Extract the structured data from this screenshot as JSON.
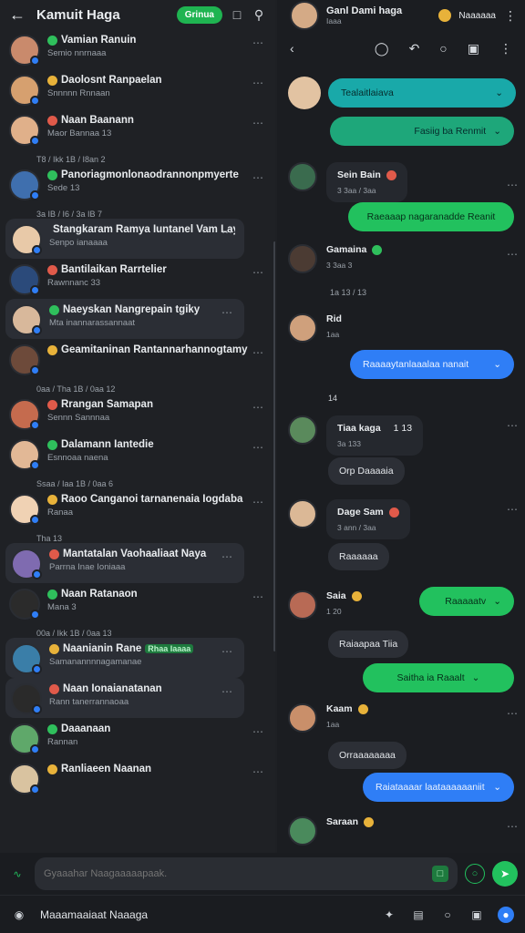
{
  "left": {
    "title": "Kamuit Haga",
    "badge": "Grinua",
    "chats": [
      {
        "name": "Vamian Ranuin",
        "sub": "Semio nnrnaaa",
        "color": "#c98a6c",
        "time": ""
      },
      {
        "name": "Daolosnt Ranpaelan",
        "sub": "Snnnnn Rnnaan",
        "color": "#d6a06f",
        "time": ""
      },
      {
        "name": "Naan Baanann",
        "sub": "Maor Bannaa 13",
        "color": "#e0b08a",
        "time": "T8 / Ikk 1B / I8an 2"
      },
      {
        "name": "Panoriagmonlonaodrannonpmyerte",
        "sub": "Sede 13",
        "color": "#3f6fae",
        "time": "3a IB / I6 / 3a IB 7"
      },
      {
        "name": "Stangkaram Ramya Iuntanel Vam Lay",
        "sub": "Senpo ianaaaa",
        "color": "#e8c9a8",
        "time": ""
      },
      {
        "name": "Bantilaikan Rarrtelier",
        "sub": "Rawnnanc 33",
        "color": "#2b4a7a",
        "time": ""
      },
      {
        "name": "Naeyskan Nangrepain tgiky",
        "sub": "Mta inannarassannaat",
        "color": "#d8b89b",
        "time": ""
      },
      {
        "name": "Geamitaninan Rantannarhannogtamy",
        "sub": "",
        "color": "#6d4a3a",
        "time": "0aa / Tha 1B / 0aa 12"
      },
      {
        "name": "Rrangan Samapan",
        "sub": "Sennn Sannnaa",
        "color": "#c56b4e",
        "time": ""
      },
      {
        "name": "Dalamann Iantedie",
        "sub": "Esnnoaa naena",
        "color": "#e2b896",
        "time": "Ssaa / Iaa 1B / 0aa 6"
      },
      {
        "name": "Raoo Canganoi tarnanenaia Iogdaba",
        "sub": "Ranaa",
        "color": "#f0d2b4",
        "time": "Tha 13"
      },
      {
        "name": "Mantatalan Vaohaaliaat Naya",
        "sub": "Parrna Inae Ioniaaa",
        "color": "#7f6bb0",
        "time": ""
      },
      {
        "name": "Naan Ratanaon",
        "sub": "Mana 3",
        "color": "#2b2b2b",
        "time": "00a / Ikk 1B / 0aa 13"
      },
      {
        "name": "Naanianin Rane",
        "sub": "Samanannnnagamanae",
        "color": "#3a7ea8",
        "time": ""
      },
      {
        "name": "Naan Ionaianatanan",
        "sub": "Rann tanerrannaoaa",
        "color": "#2a2a2a",
        "time": ""
      },
      {
        "name": "Daaanaan",
        "sub": "Rannan",
        "color": "#5fa86a",
        "time": ""
      },
      {
        "name": "Ranliaeen Naanan",
        "sub": "",
        "color": "#d9c3a0",
        "time": ""
      }
    ],
    "tag": "Rhaa Iaaaa"
  },
  "right": {
    "title": "Ganl Dami haga",
    "sub": "Iaaa",
    "status": "Naaaaaa",
    "messages": {
      "m1": "Tealaitlaiava",
      "m2": "Fasiig ba Renmit",
      "m3_name": "Sein Bain",
      "m3_meta": "3 3aa / 3aa",
      "m4": "Raeaaap nagaranadde Reanit",
      "m5_name": "Gamaina",
      "m5_meta": "3 3aa 3",
      "m5_time": "1a 13 / 13",
      "m6_name": "Rid",
      "m6_meta": "1aa",
      "m7": "Raaaaytanlaaalaa nanait",
      "m8_label": "14",
      "m9_name": "Tiaa kaga",
      "m9_count": "1 13",
      "m9_meta": "3a 133",
      "m10": "Orp Daaaaia",
      "m11_name": "Dage Sam",
      "m11_meta": "3 ann / 3aa",
      "m12": "Raaaaaa",
      "m13_name": "Saia",
      "m13_meta": "1 20",
      "m14": "Raaaaatv",
      "m15": "Raiaapaa Tiia",
      "m16": "Saitha ia Raaalt",
      "m17_name": "Kaam",
      "m17_meta": "1aa",
      "m18": "Orraaaaaaaa",
      "m19": "Raiataaaar laataaaaaaniit",
      "m20_name": "Saraan"
    }
  },
  "input": {
    "placeholder": "Gyaaahar Naagaaaaapaak."
  },
  "nav": {
    "title": "Maaamaaiaat Naaaga"
  }
}
